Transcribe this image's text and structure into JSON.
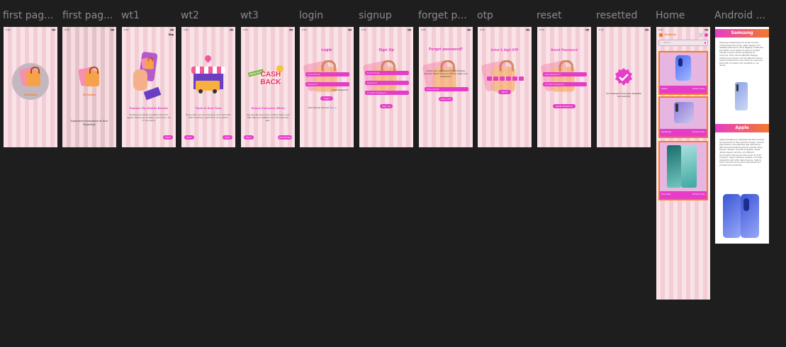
{
  "labels": [
    "first pag...",
    "first pag...",
    "wt1",
    "wt2",
    "wt3",
    "login",
    "signup",
    "forget p...",
    "otp",
    "reset",
    "resetted",
    "Home",
    "Android ..."
  ],
  "status": {
    "time": "9:41",
    "signal": "▮▮▮"
  },
  "colors": {
    "bg": "#1e1e1e",
    "frame": "#f9e3e7",
    "accent": "#e63cc8",
    "orange": "#f37a2b"
  },
  "splash": {
    "brand": "JM Mobiles",
    "tagline": "Experience Innovative at Your Fingertips"
  },
  "wt1": {
    "skip": "Skip",
    "title": "Explore Top Mobile Brands",
    "desc": "Browse the latest smartphones from Apple, Samsung, OnePlus, and more—all in one place.",
    "next": "Next"
  },
  "wt2": {
    "title": "Track in Real Time",
    "desc": "Enjoy fast, secure checkout, and real-time order tracking—right from your phone.",
    "back": "Back",
    "next": "Next"
  },
  "wt3": {
    "cash": "CASH",
    "back_word": "BACK",
    "mega": "MEGA SALE",
    "title": "Unlock Exclusive Offers",
    "desc": "Get special discounts, instant deals, and EMI options available only through this app.",
    "back": "Back",
    "start": "Get Started"
  },
  "login": {
    "title": "Login",
    "email": "Enter Email",
    "password": "Password",
    "forgot": "Forget Password?",
    "button": "Login",
    "footer": "Don't have an account?",
    "footer_link": "Sign up"
  },
  "signup": {
    "title": "Sign Up",
    "email": "Enter Email",
    "password": "Password",
    "confirm": "Confirm Password",
    "button": "Sign Up"
  },
  "forget": {
    "title": "Forget password?",
    "desc": "Enter your registered Email Address number. We'll send you OTP to reset your password.",
    "email": "Enter Email",
    "button": "Send OTP"
  },
  "otp": {
    "title": "Enter 6 digit OTP",
    "button": "Verify"
  },
  "reset": {
    "title": "Reset Password",
    "new_password": "New Password",
    "confirm": "Confirm Password",
    "button": "Reset Password"
  },
  "resetted": {
    "message": "Your Password has been Resetted Successfully"
  },
  "home": {
    "brand": "JM Mobiles",
    "search": "Search",
    "cards": [
      {
        "name": "Apple",
        "link": "Know more"
      },
      {
        "name": "Samsung",
        "link": "Know more"
      },
      {
        "name": "One Plus",
        "link": "Know more"
      }
    ]
  },
  "android": {
    "samsung_title": "Samsung",
    "samsung_text": "Samsung smartphones are known for their cutting-edge technology, sleek designs, and reliable performance. From flagship models like the Galaxy S and Galaxy Z series to budget-friendly A series, there's something for everyone. Their vibrant AMOLED displays, advanced processors, and exceptional camera systems make them a top choice for users who want both innovation and versatility in one device.",
    "apple_title": "Apple",
    "apple_text": "Apple smartphones, especially the iPhone series, are renowned for their premium design, smooth performance, and seamless user experience. With advanced features like the A-series chips, top-tier cameras, and iOS ecosystem, Apple delivers speed, security, and efficient functionality. iPhones are also known for their longevity, regular software updates, and deep integration with other Apple devices, making them a favorite among tech enthusiasts and professionals worldwide."
  }
}
